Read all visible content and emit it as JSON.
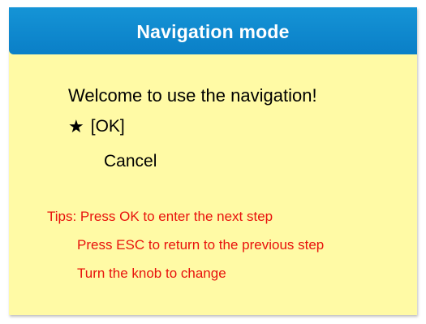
{
  "header": {
    "title": "Navigation mode"
  },
  "body": {
    "welcome": "Welcome to use the navigation!"
  },
  "menu": {
    "selector_icon": "star-icon",
    "items": [
      {
        "label": "[OK]",
        "selected": true
      },
      {
        "label": "Cancel",
        "selected": false
      }
    ]
  },
  "tips": [
    "Tips: Press OK to enter the next step",
    "Press ESC to return to the previous step",
    "Turn the knob to change"
  ],
  "colors": {
    "header_bg": "#0a86cc",
    "panel_bg": "#fffaa5",
    "tip_text": "#e8120c"
  }
}
